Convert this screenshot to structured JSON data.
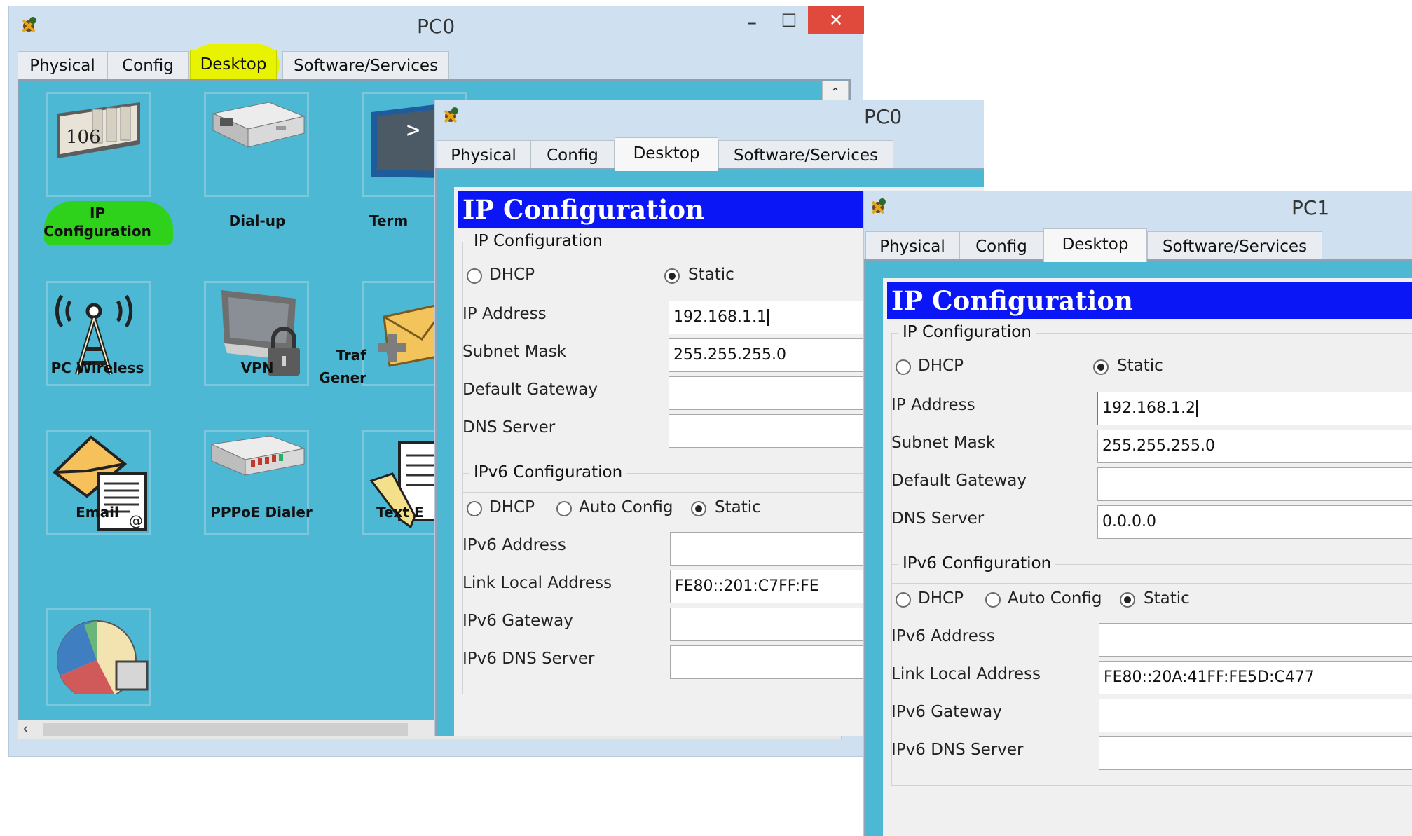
{
  "pc0_main": {
    "title": "PC0",
    "tabs": [
      "Physical",
      "Config",
      "Desktop",
      "Software/Services"
    ],
    "active_tab": "Desktop",
    "highlight_color": "#e8f300",
    "desktop_apps": [
      "IP Configuration",
      "Dial-up",
      "Term",
      "PC Wireless",
      "VPN",
      "Traf Gener",
      "Email",
      "PPPoE Dialer",
      "Text E"
    ],
    "tile_106_text": "106",
    "terminal_prompt": ">",
    "controls": {
      "minimize": "–",
      "maximize": "□",
      "close": "✕"
    }
  },
  "pc0_ip": {
    "title": "PC0",
    "tabs": [
      "Physical",
      "Config",
      "Desktop",
      "Software/Services"
    ],
    "active_tab": "Desktop",
    "banner": "IP Configuration",
    "ipv4_group": "IP Configuration",
    "dhcp_label": "DHCP",
    "static_label": "Static",
    "ipv4_mode": "Static",
    "ip_address_label": "IP Address",
    "ip_address": "192.168.1.1",
    "subnet_label": "Subnet Mask",
    "subnet": "255.255.255.0",
    "gateway_label": "Default Gateway",
    "gateway": "",
    "dns_label": "DNS Server",
    "dns": "",
    "ipv6_group": "IPv6 Configuration",
    "auto_config_label": "Auto Config",
    "ipv6_mode": "Static",
    "ipv6_address_label": "IPv6 Address",
    "ipv6_address": "",
    "link_local_label": "Link Local Address",
    "link_local": "FE80::201:C7FF:FE",
    "ipv6_gateway_label": "IPv6 Gateway",
    "ipv6_gateway": "",
    "ipv6_dns_label": "IPv6 DNS Server",
    "ipv6_dns": ""
  },
  "pc1_ip": {
    "title": "PC1",
    "tabs": [
      "Physical",
      "Config",
      "Desktop",
      "Software/Services"
    ],
    "active_tab": "Desktop",
    "banner": "IP Configuration",
    "ipv4_group": "IP Configuration",
    "dhcp_label": "DHCP",
    "static_label": "Static",
    "ipv4_mode": "Static",
    "ip_address_label": "IP Address",
    "ip_address": "192.168.1.2",
    "subnet_label": "Subnet Mask",
    "subnet": "255.255.255.0",
    "gateway_label": "Default Gateway",
    "gateway": "",
    "dns_label": "DNS Server",
    "dns": "0.0.0.0",
    "ipv6_group": "IPv6 Configuration",
    "auto_config_label": "Auto Config",
    "ipv6_mode": "Static",
    "ipv6_address_label": "IPv6 Address",
    "ipv6_address": "",
    "link_local_label": "Link Local Address",
    "link_local": "FE80::20A:41FF:FE5D:C477",
    "ipv6_gateway_label": "IPv6 Gateway",
    "ipv6_gateway": "",
    "ipv6_dns_label": "IPv6 DNS Server",
    "ipv6_dns": ""
  },
  "colors": {
    "desktop_bg": "#4cb8d4",
    "banner_blue": "#0a16f5",
    "titlebar": "#cfe1f1",
    "close_red": "#e04a3c",
    "highlight_green": "#2fd21b"
  }
}
